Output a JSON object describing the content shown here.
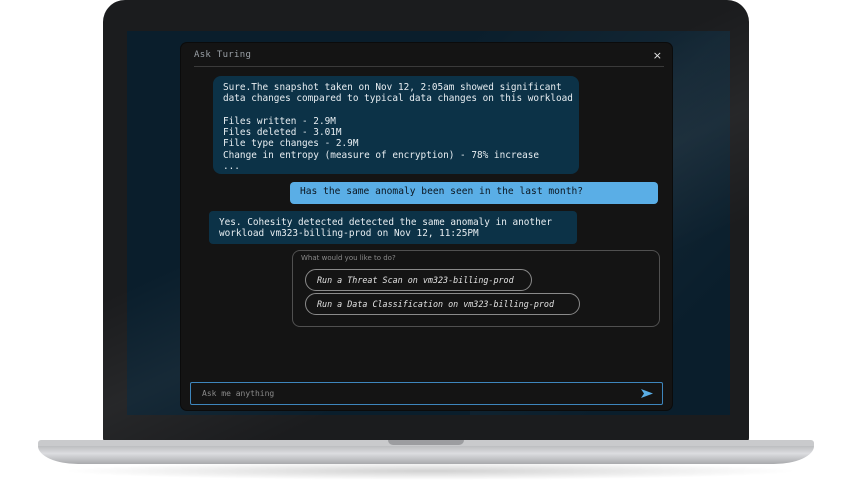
{
  "panel": {
    "title": "Ask Turing",
    "close_label": "×"
  },
  "messages": [
    {
      "role": "bot",
      "text": "Sure.The snapshot taken on Nov 12, 2:05am showed significant\ndata changes compared to typical data changes on this workload\n\nFiles written - 2.9M\nFiles deleted - 3.01M\nFile type changes - 2.9M\nChange in entropy (measure of encryption) - 78% increase\n..."
    },
    {
      "role": "user",
      "text": "Has the same anomaly been seen in the last month?"
    },
    {
      "role": "bot",
      "text": "Yes. Cohesity detected detected the same anomaly in another\nworkload vm323-billing-prod on Nov 12, 11:25PM"
    }
  ],
  "actions": {
    "prompt": "What would you like to do?",
    "items": [
      "Run a Threat Scan on vm323-billing-prod",
      "Run a Data Classification on vm323-billing-prod"
    ]
  },
  "input": {
    "placeholder": "Ask me anything",
    "send_icon": "send-arrow-icon",
    "accent": "#3e86bd"
  },
  "colors": {
    "screen_bg": "#0a1e2c",
    "panel_bg": "#141414",
    "bot_bubble": "#0c3247",
    "user_bubble": "#5aaee6"
  }
}
